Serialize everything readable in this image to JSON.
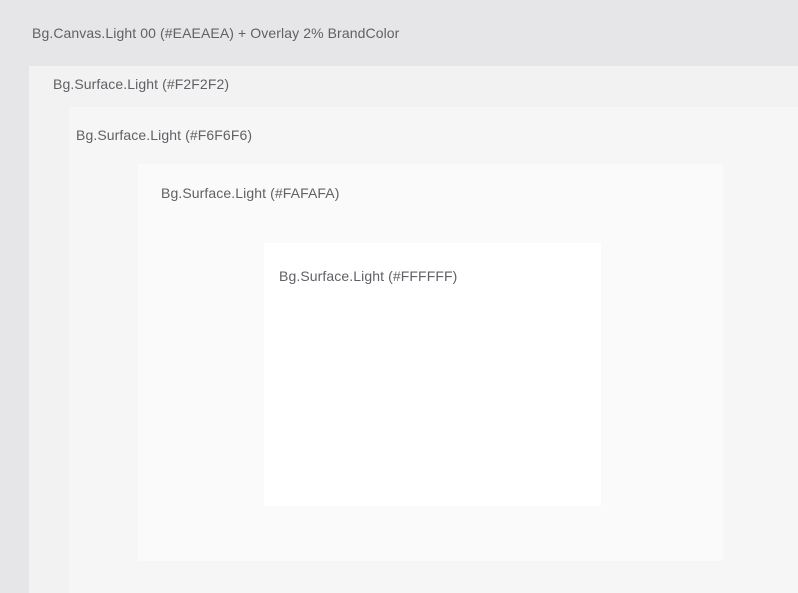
{
  "canvas": {
    "label": "Bg.Canvas.Light 00  (#EAEAEA) + Overlay  2% BrandColor",
    "color": "#e6e6e8"
  },
  "surfaces": [
    {
      "label": "Bg.Surface.Light (#F2F2F2)",
      "color": "#F2F2F2"
    },
    {
      "label": "Bg.Surface.Light  (#F6F6F6)",
      "color": "#F6F6F6"
    },
    {
      "label": "Bg.Surface.Light (#FAFAFA)",
      "color": "#FAFAFA"
    },
    {
      "label": "Bg.Surface.Light  (#FFFFFF)",
      "color": "#FFFFFF"
    }
  ],
  "text_color": "#5f6165"
}
